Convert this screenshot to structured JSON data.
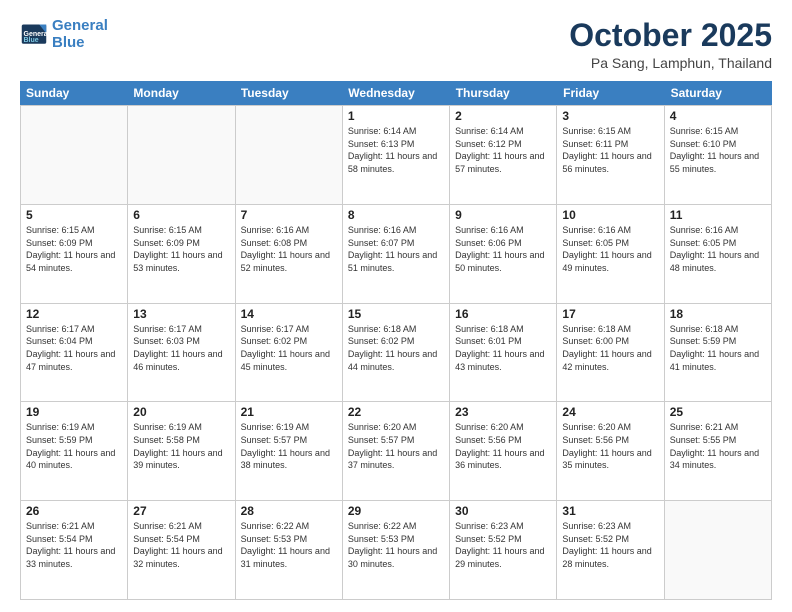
{
  "logo": {
    "line1": "General",
    "line2": "Blue"
  },
  "header": {
    "month": "October 2025",
    "location": "Pa Sang, Lamphun, Thailand"
  },
  "weekdays": [
    "Sunday",
    "Monday",
    "Tuesday",
    "Wednesday",
    "Thursday",
    "Friday",
    "Saturday"
  ],
  "weeks": [
    [
      {
        "day": "",
        "sunrise": "",
        "sunset": "",
        "daylight": ""
      },
      {
        "day": "",
        "sunrise": "",
        "sunset": "",
        "daylight": ""
      },
      {
        "day": "",
        "sunrise": "",
        "sunset": "",
        "daylight": ""
      },
      {
        "day": "1",
        "sunrise": "Sunrise: 6:14 AM",
        "sunset": "Sunset: 6:13 PM",
        "daylight": "Daylight: 11 hours and 58 minutes."
      },
      {
        "day": "2",
        "sunrise": "Sunrise: 6:14 AM",
        "sunset": "Sunset: 6:12 PM",
        "daylight": "Daylight: 11 hours and 57 minutes."
      },
      {
        "day": "3",
        "sunrise": "Sunrise: 6:15 AM",
        "sunset": "Sunset: 6:11 PM",
        "daylight": "Daylight: 11 hours and 56 minutes."
      },
      {
        "day": "4",
        "sunrise": "Sunrise: 6:15 AM",
        "sunset": "Sunset: 6:10 PM",
        "daylight": "Daylight: 11 hours and 55 minutes."
      }
    ],
    [
      {
        "day": "5",
        "sunrise": "Sunrise: 6:15 AM",
        "sunset": "Sunset: 6:09 PM",
        "daylight": "Daylight: 11 hours and 54 minutes."
      },
      {
        "day": "6",
        "sunrise": "Sunrise: 6:15 AM",
        "sunset": "Sunset: 6:09 PM",
        "daylight": "Daylight: 11 hours and 53 minutes."
      },
      {
        "day": "7",
        "sunrise": "Sunrise: 6:16 AM",
        "sunset": "Sunset: 6:08 PM",
        "daylight": "Daylight: 11 hours and 52 minutes."
      },
      {
        "day": "8",
        "sunrise": "Sunrise: 6:16 AM",
        "sunset": "Sunset: 6:07 PM",
        "daylight": "Daylight: 11 hours and 51 minutes."
      },
      {
        "day": "9",
        "sunrise": "Sunrise: 6:16 AM",
        "sunset": "Sunset: 6:06 PM",
        "daylight": "Daylight: 11 hours and 50 minutes."
      },
      {
        "day": "10",
        "sunrise": "Sunrise: 6:16 AM",
        "sunset": "Sunset: 6:05 PM",
        "daylight": "Daylight: 11 hours and 49 minutes."
      },
      {
        "day": "11",
        "sunrise": "Sunrise: 6:16 AM",
        "sunset": "Sunset: 6:05 PM",
        "daylight": "Daylight: 11 hours and 48 minutes."
      }
    ],
    [
      {
        "day": "12",
        "sunrise": "Sunrise: 6:17 AM",
        "sunset": "Sunset: 6:04 PM",
        "daylight": "Daylight: 11 hours and 47 minutes."
      },
      {
        "day": "13",
        "sunrise": "Sunrise: 6:17 AM",
        "sunset": "Sunset: 6:03 PM",
        "daylight": "Daylight: 11 hours and 46 minutes."
      },
      {
        "day": "14",
        "sunrise": "Sunrise: 6:17 AM",
        "sunset": "Sunset: 6:02 PM",
        "daylight": "Daylight: 11 hours and 45 minutes."
      },
      {
        "day": "15",
        "sunrise": "Sunrise: 6:18 AM",
        "sunset": "Sunset: 6:02 PM",
        "daylight": "Daylight: 11 hours and 44 minutes."
      },
      {
        "day": "16",
        "sunrise": "Sunrise: 6:18 AM",
        "sunset": "Sunset: 6:01 PM",
        "daylight": "Daylight: 11 hours and 43 minutes."
      },
      {
        "day": "17",
        "sunrise": "Sunrise: 6:18 AM",
        "sunset": "Sunset: 6:00 PM",
        "daylight": "Daylight: 11 hours and 42 minutes."
      },
      {
        "day": "18",
        "sunrise": "Sunrise: 6:18 AM",
        "sunset": "Sunset: 5:59 PM",
        "daylight": "Daylight: 11 hours and 41 minutes."
      }
    ],
    [
      {
        "day": "19",
        "sunrise": "Sunrise: 6:19 AM",
        "sunset": "Sunset: 5:59 PM",
        "daylight": "Daylight: 11 hours and 40 minutes."
      },
      {
        "day": "20",
        "sunrise": "Sunrise: 6:19 AM",
        "sunset": "Sunset: 5:58 PM",
        "daylight": "Daylight: 11 hours and 39 minutes."
      },
      {
        "day": "21",
        "sunrise": "Sunrise: 6:19 AM",
        "sunset": "Sunset: 5:57 PM",
        "daylight": "Daylight: 11 hours and 38 minutes."
      },
      {
        "day": "22",
        "sunrise": "Sunrise: 6:20 AM",
        "sunset": "Sunset: 5:57 PM",
        "daylight": "Daylight: 11 hours and 37 minutes."
      },
      {
        "day": "23",
        "sunrise": "Sunrise: 6:20 AM",
        "sunset": "Sunset: 5:56 PM",
        "daylight": "Daylight: 11 hours and 36 minutes."
      },
      {
        "day": "24",
        "sunrise": "Sunrise: 6:20 AM",
        "sunset": "Sunset: 5:56 PM",
        "daylight": "Daylight: 11 hours and 35 minutes."
      },
      {
        "day": "25",
        "sunrise": "Sunrise: 6:21 AM",
        "sunset": "Sunset: 5:55 PM",
        "daylight": "Daylight: 11 hours and 34 minutes."
      }
    ],
    [
      {
        "day": "26",
        "sunrise": "Sunrise: 6:21 AM",
        "sunset": "Sunset: 5:54 PM",
        "daylight": "Daylight: 11 hours and 33 minutes."
      },
      {
        "day": "27",
        "sunrise": "Sunrise: 6:21 AM",
        "sunset": "Sunset: 5:54 PM",
        "daylight": "Daylight: 11 hours and 32 minutes."
      },
      {
        "day": "28",
        "sunrise": "Sunrise: 6:22 AM",
        "sunset": "Sunset: 5:53 PM",
        "daylight": "Daylight: 11 hours and 31 minutes."
      },
      {
        "day": "29",
        "sunrise": "Sunrise: 6:22 AM",
        "sunset": "Sunset: 5:53 PM",
        "daylight": "Daylight: 11 hours and 30 minutes."
      },
      {
        "day": "30",
        "sunrise": "Sunrise: 6:23 AM",
        "sunset": "Sunset: 5:52 PM",
        "daylight": "Daylight: 11 hours and 29 minutes."
      },
      {
        "day": "31",
        "sunrise": "Sunrise: 6:23 AM",
        "sunset": "Sunset: 5:52 PM",
        "daylight": "Daylight: 11 hours and 28 minutes."
      },
      {
        "day": "",
        "sunrise": "",
        "sunset": "",
        "daylight": ""
      }
    ]
  ]
}
